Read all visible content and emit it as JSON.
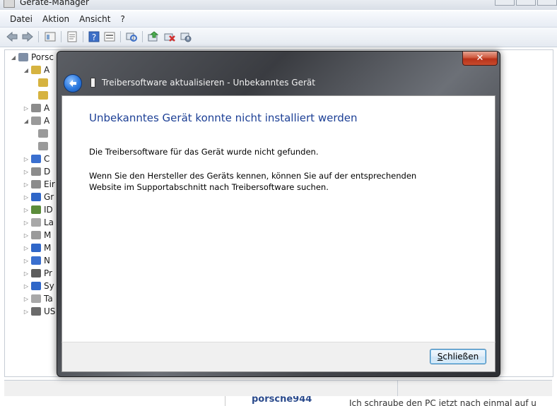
{
  "device_manager": {
    "title": "Geräte-Manager",
    "menu": [
      "Datei",
      "Aktion",
      "Ansicht",
      "?"
    ],
    "tree": [
      {
        "label": "Porsc",
        "expanded": true,
        "icon": "computer-icon",
        "color": "#7f8fa6"
      },
      {
        "label": "A",
        "expanded": true,
        "icon": "warning-icon",
        "color": "#d6b340"
      },
      {
        "label": "A",
        "expanded": false,
        "icon": "audio-icon",
        "color": "#8c8c8c"
      },
      {
        "label": "A",
        "expanded": true,
        "icon": "speaker-icon",
        "color": "#9a9a9a"
      },
      {
        "label": "C",
        "expanded": false,
        "icon": "computer-icon",
        "color": "#3a6fcf"
      },
      {
        "label": "D",
        "expanded": false,
        "icon": "dvd-icon",
        "color": "#8c8c8c"
      },
      {
        "label": "Eir",
        "expanded": false,
        "icon": "keyboard-icon",
        "color": "#8c8c8c"
      },
      {
        "label": "Gr",
        "expanded": false,
        "icon": "display-icon",
        "color": "#2f66c8"
      },
      {
        "label": "ID",
        "expanded": false,
        "icon": "disk-icon",
        "color": "#5b8c3a"
      },
      {
        "label": "La",
        "expanded": false,
        "icon": "drive-icon",
        "color": "#a8a8a8"
      },
      {
        "label": "M",
        "expanded": false,
        "icon": "mouse-icon",
        "color": "#9a9a9a"
      },
      {
        "label": "M",
        "expanded": false,
        "icon": "monitor-icon",
        "color": "#2f66c8"
      },
      {
        "label": "N",
        "expanded": false,
        "icon": "network-icon",
        "color": "#3a6fcf"
      },
      {
        "label": "Pr",
        "expanded": false,
        "icon": "processor-icon",
        "color": "#5c5c5c"
      },
      {
        "label": "Sy",
        "expanded": false,
        "icon": "system-icon",
        "color": "#2f66c8"
      },
      {
        "label": "Ta",
        "expanded": false,
        "icon": "keyboard-icon",
        "color": "#a8a8a8"
      },
      {
        "label": "US",
        "expanded": false,
        "icon": "usb-icon",
        "color": "#6b6b6b"
      }
    ],
    "background_web": {
      "author": "porsche944",
      "text": "Ich schraube den PC jetzt nach einmal auf u"
    }
  },
  "wizard": {
    "title": "Treibersoftware aktualisieren - Unbekanntes Gerät",
    "heading": "Unbekanntes Gerät konnte nicht installiert werden",
    "message1": "Die Treibersoftware für das Gerät wurde nicht gefunden.",
    "message2": "Wenn Sie den Hersteller des Geräts kennen, können Sie auf der entsprechenden Website im Supportabschnitt nach Treibersoftware suchen.",
    "close_button": {
      "accel": "S",
      "rest": "chließen"
    },
    "colors": {
      "heading": "#1c3f95",
      "close_red": "#c74b2d",
      "back_blue": "#2b78de"
    }
  }
}
